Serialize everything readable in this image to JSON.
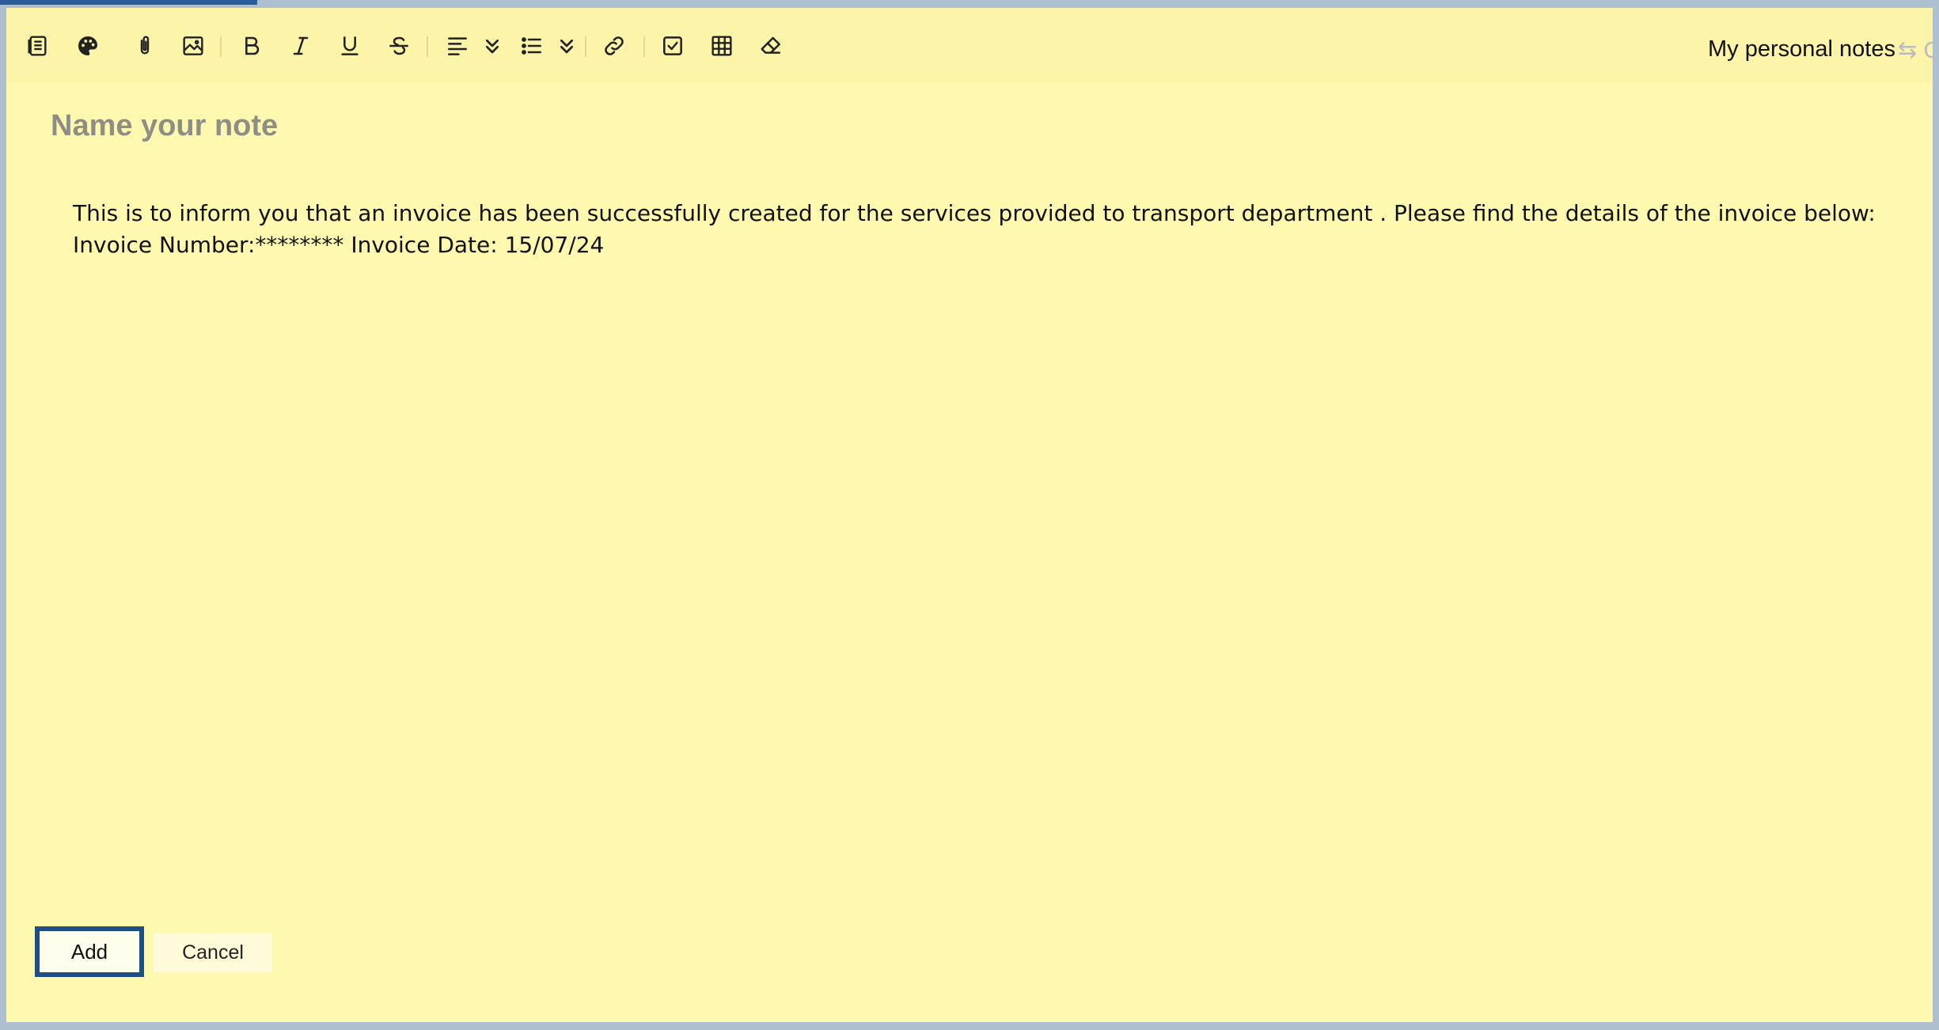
{
  "toolbar": {
    "notebook_label": "My personal notes",
    "notebook_extra": "⇆ C",
    "buttons": [
      {
        "name": "notebook-icon"
      },
      {
        "name": "palette-icon"
      },
      {
        "name": "attachment-icon"
      },
      {
        "name": "image-icon"
      },
      {
        "name": "bold-icon"
      },
      {
        "name": "italic-icon"
      },
      {
        "name": "underline-icon"
      },
      {
        "name": "strikethrough-icon"
      },
      {
        "name": "align-left-icon"
      },
      {
        "name": "chevron-down-icon"
      },
      {
        "name": "bullet-list-icon"
      },
      {
        "name": "chevron-down-icon"
      },
      {
        "name": "link-icon"
      },
      {
        "name": "checkbox-icon"
      },
      {
        "name": "table-icon"
      },
      {
        "name": "eraser-icon"
      }
    ]
  },
  "editor": {
    "title_placeholder": "Name your note",
    "title_value": "",
    "body": "This is to inform you that an invoice has been successfully created for the services provided to transport department . Please find the details of the invoice below:\nInvoice Number:******** Invoice Date: 15/07/24"
  },
  "footer": {
    "add_label": "Add",
    "cancel_label": "Cancel"
  },
  "colors": {
    "note_background": "#fff9b0",
    "toolbar_background": "#fcf4a8",
    "focus_border": "#1f4e86"
  }
}
